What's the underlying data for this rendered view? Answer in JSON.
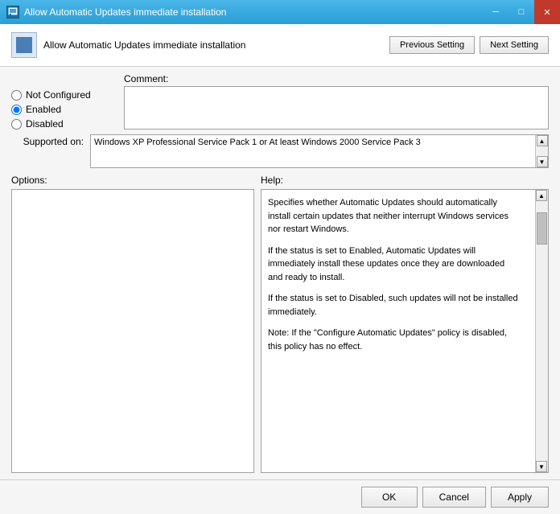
{
  "titlebar": {
    "title": "Allow Automatic Updates immediate installation",
    "icon": "policy-icon",
    "min_btn": "─",
    "max_btn": "□",
    "close_btn": "✕"
  },
  "header": {
    "policy_name": "Allow Automatic Updates immediate installation",
    "prev_button": "Previous Setting",
    "next_button": "Next Setting"
  },
  "radios": {
    "not_configured": "Not Configured",
    "enabled": "Enabled",
    "disabled": "Disabled"
  },
  "selected_radio": "enabled",
  "comment": {
    "label": "Comment:",
    "value": "",
    "placeholder": ""
  },
  "supported": {
    "label": "Supported on:",
    "text": "Windows XP Professional Service Pack 1 or At least Windows 2000 Service Pack 3"
  },
  "options_label": "Options:",
  "help_label": "Help:",
  "help_paragraphs": [
    "Specifies whether Automatic Updates should automatically install certain updates that neither interrupt Windows services nor restart Windows.",
    "If the status is set to Enabled, Automatic Updates will immediately install these updates once they are downloaded and ready to install.",
    "If the status is set to Disabled, such updates will not be installed immediately.",
    "Note: If the \"Configure Automatic Updates\" policy is disabled, this policy has no effect."
  ],
  "footer": {
    "ok_label": "OK",
    "cancel_label": "Cancel",
    "apply_label": "Apply"
  }
}
